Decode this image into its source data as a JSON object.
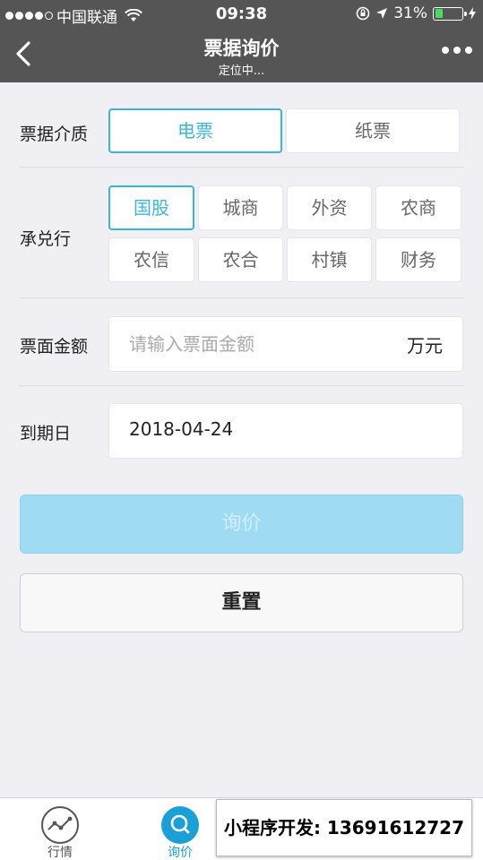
{
  "status_bar": {
    "carrier": "中国联通",
    "time": "09:38",
    "battery": "31%",
    "battery_level": 0.31
  },
  "nav": {
    "title": "票据询价",
    "subtitle": "定位中..."
  },
  "form": {
    "medium": {
      "label": "票据介质",
      "options": [
        "电票",
        "纸票"
      ],
      "selected": "电票"
    },
    "bank": {
      "label": "承兑行",
      "options": [
        "国股",
        "城商",
        "外资",
        "农商",
        "农信",
        "农合",
        "村镇",
        "财务"
      ],
      "selected": "国股"
    },
    "amount": {
      "label": "票面金额",
      "placeholder": "请输入票面金额",
      "value": "",
      "unit": "万元"
    },
    "due_date": {
      "label": "到期日",
      "value": "2018-04-24"
    }
  },
  "buttons": {
    "query": "询价",
    "reset": "重置"
  },
  "tabbar": {
    "tabs": [
      {
        "label": "行情",
        "icon": "trend-chart-icon"
      },
      {
        "label": "询价",
        "icon": "search-icon",
        "active": true
      }
    ]
  },
  "overlay": {
    "text": "小程序开发: 13691612727"
  },
  "colors": {
    "accent": "#3bb6d9",
    "navbar": "#555555",
    "query_button": "#9fdcf3",
    "background": "#efeff4"
  }
}
